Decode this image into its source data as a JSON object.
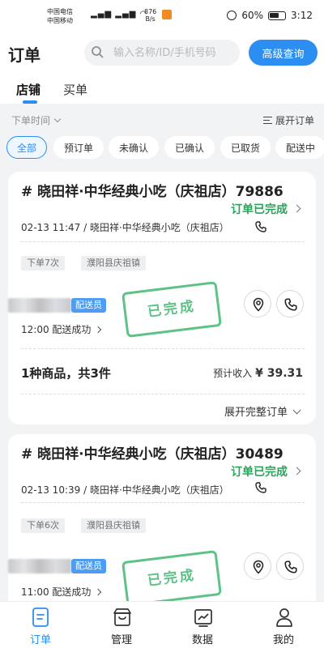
{
  "status_bar": {
    "carrier1": "中国电信",
    "carrier2": "中国移动",
    "net_speed": "876",
    "net_unit": "B/s",
    "battery": "60%",
    "time": "3:12"
  },
  "header": {
    "title": "订单",
    "search_placeholder": "输入名称/ID/手机号码",
    "advanced_search": "高级查询",
    "tabs": [
      "店铺",
      "买单"
    ]
  },
  "filters": {
    "time_filter": "下单时间",
    "expand_orders": "展开订单",
    "chips": [
      "全部",
      "预订单",
      "未确认",
      "已确认",
      "已取货",
      "配送中"
    ]
  },
  "orders": [
    {
      "title": "# 晓田祥·中华经典小吃（庆祖店）79886",
      "status": "订单已完成",
      "meta": "02-13 11:47 / 晓田祥·中华经典小吃（庆祖店）",
      "tags": [
        "下单7次",
        "濮阳县庆祖镇"
      ],
      "courier_badge": "配送员",
      "delivery_status": "12:00 配送成功",
      "stamp": "已完成",
      "summary": "1种商品，共3件",
      "income_label": "预计收入",
      "income_value": "¥ 39.31",
      "expand_full": "展开完整订单"
    },
    {
      "title": "# 晓田祥·中华经典小吃（庆祖店）30489",
      "status": "订单已完成",
      "meta": "02-13 10:39 / 晓田祥·中华经典小吃（庆祖店）",
      "tags": [
        "下单6次",
        "濮阳县庆祖镇"
      ],
      "courier_badge": "配送员",
      "delivery_status": "11:00 配送成功",
      "stamp": "已完成"
    }
  ],
  "bottom_nav": [
    {
      "label": "订单",
      "icon": "orders-icon",
      "active": true
    },
    {
      "label": "管理",
      "icon": "manage-icon",
      "active": false
    },
    {
      "label": "数据",
      "icon": "data-chart-icon",
      "active": false
    },
    {
      "label": "我的",
      "icon": "profile-icon",
      "active": false
    }
  ],
  "colors": {
    "accent": "#2b8ef0",
    "success": "#29a55a",
    "background": "#f2f3f5"
  }
}
